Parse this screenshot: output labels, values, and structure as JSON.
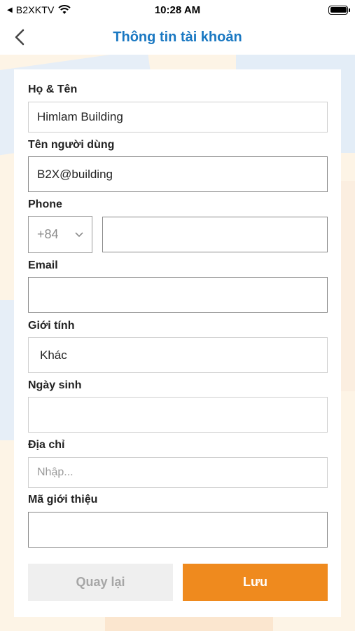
{
  "status_bar": {
    "carrier": "B2XKTV",
    "time": "10:28 AM"
  },
  "header": {
    "title": "Thông tin tài khoản"
  },
  "form": {
    "full_name": {
      "label": "Họ & Tên",
      "value": "Himlam Building"
    },
    "username": {
      "label": "Tên người dùng",
      "value": "B2X@building"
    },
    "phone": {
      "label": "Phone",
      "country_code": "+84",
      "value": ""
    },
    "email": {
      "label": "Email",
      "value": ""
    },
    "gender": {
      "label": "Giới tính",
      "value": "Khác"
    },
    "birthday": {
      "label": "Ngày sinh",
      "value": ""
    },
    "address": {
      "label": "Địa chỉ",
      "placeholder": "Nhập..."
    },
    "referral": {
      "label": "Mã giới thiệu",
      "value": ""
    }
  },
  "buttons": {
    "back_label": "Quay lại",
    "save_label": "Lưu"
  },
  "colors": {
    "title": "#1a78c2",
    "save_button": "#ef8a1e",
    "back_button_bg": "#efefef"
  }
}
